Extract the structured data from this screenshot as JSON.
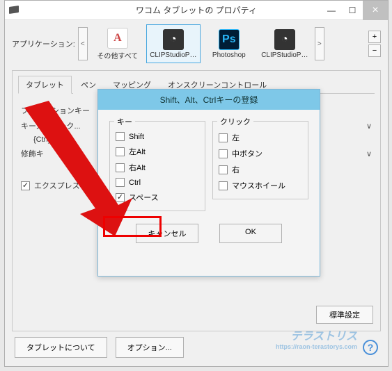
{
  "window": {
    "title": "ワコム タブレットの プロパティ"
  },
  "apps": {
    "label": "アプリケーション:",
    "items": [
      {
        "label": "その他すべて"
      },
      {
        "label": "CLIPStudioP…"
      },
      {
        "label": "Photoshop"
      },
      {
        "label": "CLIPStudioP…"
      }
    ]
  },
  "tabs": {
    "items": [
      {
        "label": "タブレット"
      },
      {
        "label": "ペン"
      },
      {
        "label": "マッピング"
      },
      {
        "label": "オンスクリーンコントロール"
      }
    ]
  },
  "content": {
    "function_key": "ファンクションキー",
    "keystroke": "キーストローク...",
    "keystroke_value": "{Ctrl}s",
    "modifier": "修飾キ",
    "express_view": "エクスプレスビ"
  },
  "default_btn": "標準設定",
  "bottom": {
    "about": "タブレットについて",
    "options": "オプション..."
  },
  "dialog": {
    "title": "Shift、Alt、Ctrlキーの登録",
    "key_group": "キー",
    "click_group": "クリック",
    "keys": {
      "shift": "Shift",
      "lalt": "左Alt",
      "ralt": "右Alt",
      "ctrl": "Ctrl",
      "space": "スペース"
    },
    "clicks": {
      "left": "左",
      "middle": "中ボタン",
      "right": "右",
      "wheel": "マウスホイール"
    },
    "cancel": "キャンセル",
    "ok": "OK"
  },
  "watermark": {
    "main": "テラストリス",
    "sub": "https://raon-terastorys.com"
  }
}
